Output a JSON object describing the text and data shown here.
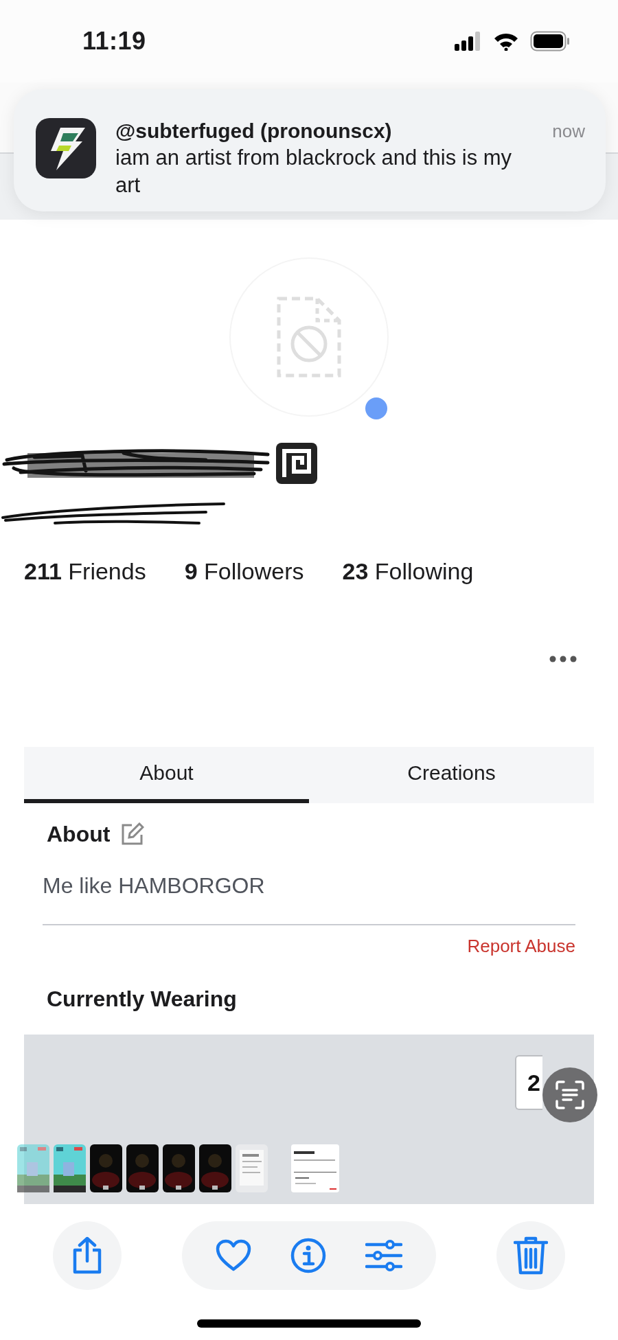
{
  "status_bar": {
    "time": "11:19"
  },
  "notification": {
    "title": "@subterfuged (pronounscx)",
    "message": "iam an artist from blackrock and this is my  art",
    "time": "now"
  },
  "stats": [
    "**211** Friends",
    "**9** Followers",
    "**23** Following"
  ],
  "tabs": [
    {
      "label": "About",
      "selected": true
    },
    {
      "label": "Creations",
      "selected": false
    }
  ],
  "about": {
    "heading": "About",
    "text": "Me like HAMBORGOR",
    "report": "Report Abuse"
  },
  "wearing": {
    "heading": "Currently Wearing",
    "view_toggle": "2"
  },
  "thumbnails": [
    {
      "kind": "game"
    },
    {
      "kind": "game"
    },
    {
      "kind": "dark"
    },
    {
      "kind": "dark"
    },
    {
      "kind": "dark"
    },
    {
      "kind": "dark"
    },
    {
      "kind": "document"
    },
    {
      "kind": "page"
    }
  ]
}
